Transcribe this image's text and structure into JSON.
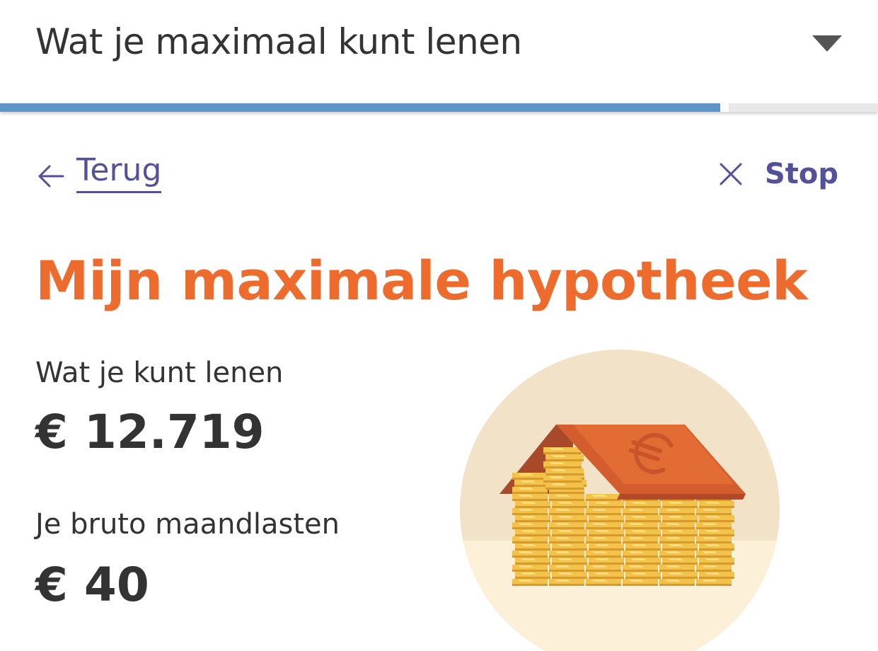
{
  "header": {
    "title": "Wat je maximaal kunt lenen",
    "dropdown_icon": "caret-down-icon"
  },
  "progress": {
    "fraction": 0.82,
    "fill_color": "#5f94c9"
  },
  "nav": {
    "back_label": "Terug",
    "back_icon": "arrow-left-icon",
    "stop_label": "Stop",
    "stop_icon": "close-icon",
    "link_color": "#525199"
  },
  "main": {
    "title": "Mijn maximale hypotheek",
    "title_color": "#ec6b2d",
    "fields": [
      {
        "label": "Wat je kunt lenen",
        "value": "€ 12.719"
      },
      {
        "label": "Je bruto maandlasten",
        "value": "€ 40"
      }
    ],
    "illustration": "coin-house-euro-icon"
  }
}
